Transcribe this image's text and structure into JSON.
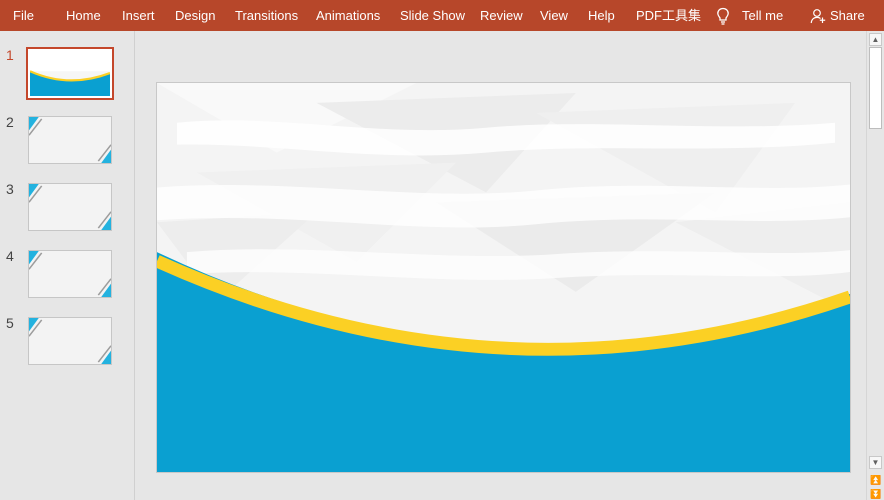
{
  "ribbon": {
    "tabs": [
      {
        "label": "File"
      },
      {
        "label": "Home"
      },
      {
        "label": "Insert"
      },
      {
        "label": "Design"
      },
      {
        "label": "Transitions"
      },
      {
        "label": "Animations"
      },
      {
        "label": "Slide Show"
      },
      {
        "label": "Review"
      },
      {
        "label": "View"
      },
      {
        "label": "Help"
      },
      {
        "label": "PDF工具集"
      }
    ],
    "tell_me": "Tell me",
    "share": "Share",
    "color": "#b7472a"
  },
  "thumbnails": {
    "numbers": [
      "1",
      "2",
      "3",
      "4",
      "5"
    ],
    "selected": "1"
  },
  "theme": {
    "blue": "#0aa0d1",
    "gold": "#fbd024",
    "accent_active": "#c4472b"
  }
}
